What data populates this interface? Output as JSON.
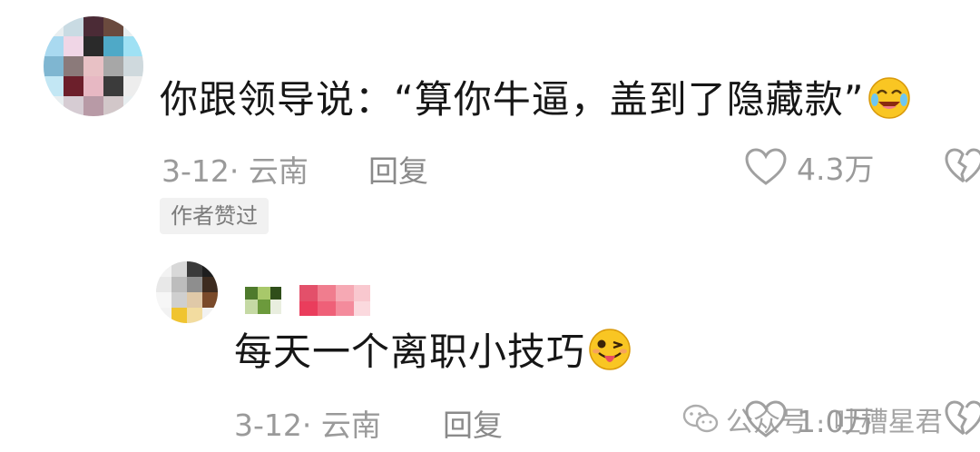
{
  "comment": {
    "text": "你跟领导说：“算你牛逼，盖到了隐藏款”",
    "date_location": "3-12· 云南",
    "reply_label": "回复",
    "likes": "4.3万",
    "author_badge": "作者赞过",
    "emoji": "laughing-crying-emoji"
  },
  "reply": {
    "text": "每天一个离职小技巧",
    "date_location": "3-12· 云南",
    "reply_label": "回复",
    "likes": "1.0万",
    "emoji": "winking-tongue-emoji"
  },
  "watermark": {
    "text": "公众号 · 吐槽星君"
  },
  "colors": {
    "text": "#161616",
    "meta": "#9a9a9a",
    "badge_bg": "#f1f1f1"
  }
}
